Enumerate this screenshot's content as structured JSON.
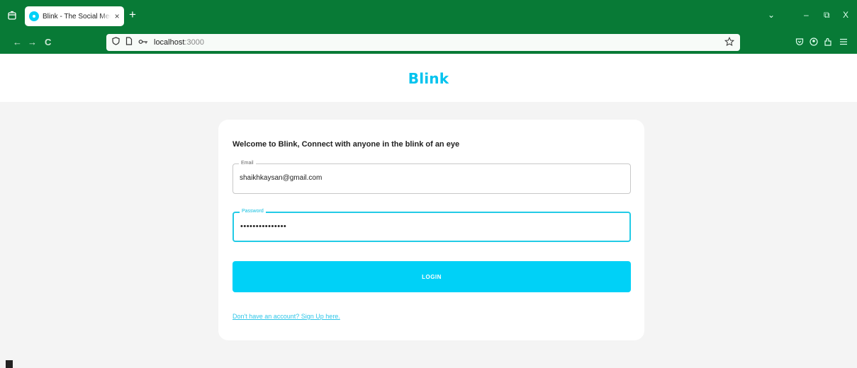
{
  "browser": {
    "tab": {
      "title": "Blink - The Social Media Platform",
      "close": "×"
    },
    "new_tab": "+",
    "window_controls": {
      "list_tabs": "⌄",
      "minimize": "–",
      "restore": "⧉",
      "close": "X"
    },
    "nav": {
      "back": "←",
      "forward": "→",
      "reload": "C"
    },
    "url": {
      "host": "localhost",
      "port": ":3000"
    }
  },
  "page": {
    "brand": "Blink",
    "welcome": "Welcome to Blink, Connect with anyone in the blink of an eye",
    "email": {
      "label": "Email",
      "value": "shaikhkaysan@gmail.com"
    },
    "password": {
      "label": "Password",
      "value": "•••••••••••••••"
    },
    "login_button": "LOGIN",
    "signup_link": "Don't have an account? Sign Up here."
  },
  "colors": {
    "chrome": "#087a36",
    "accent": "#00d1f7",
    "brand": "#00c3ee"
  }
}
